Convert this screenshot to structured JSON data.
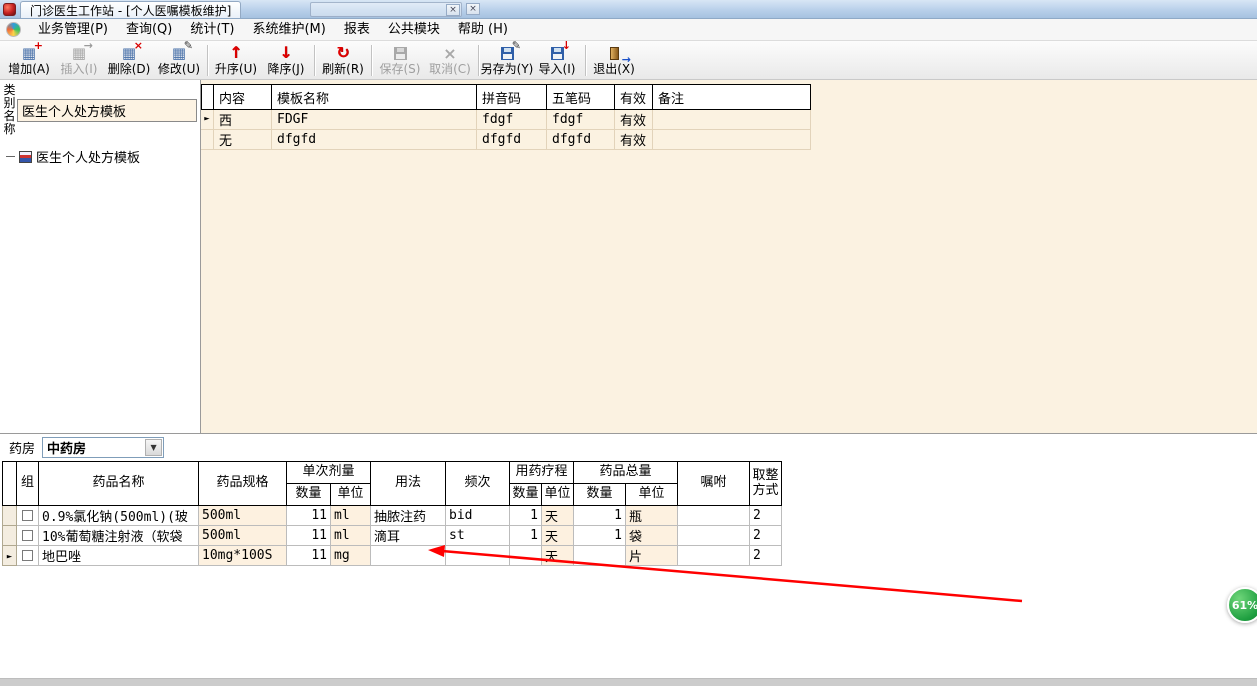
{
  "window": {
    "title": "门诊医生工作站 - [个人医嘱模板维护]"
  },
  "menu_bar": {
    "items": [
      "业务管理(P)",
      "查询(Q)",
      "统计(T)",
      "系统维护(M)",
      "报表",
      "公共模块",
      "帮助 (H)"
    ]
  },
  "toolbar": {
    "buttons": [
      {
        "label": "增加(A)",
        "enabled": true,
        "glyph": "▦",
        "overlay": "+"
      },
      {
        "label": "插入(I)",
        "enabled": false,
        "glyph": "▦",
        "overlay": "→"
      },
      {
        "label": "删除(D)",
        "enabled": true,
        "glyph": "▦",
        "overlay": "×"
      },
      {
        "label": "修改(U)",
        "enabled": true,
        "glyph": "▦",
        "overlay": "✎"
      },
      {
        "label": "升序(U)",
        "enabled": true,
        "glyph": "↑"
      },
      {
        "label": "降序(J)",
        "enabled": true,
        "glyph": "↓"
      },
      {
        "label": "刷新(R)",
        "enabled": true,
        "glyph": "↻"
      },
      {
        "label": "保存(S)",
        "enabled": false
      },
      {
        "label": "取消(C)",
        "enabled": false,
        "glyph": "×"
      },
      {
        "label": "另存为(Y)",
        "enabled": true,
        "overlay": "✎"
      },
      {
        "label": "导入(I)",
        "enabled": true,
        "overlay": "↓"
      },
      {
        "label": "退出(X)",
        "enabled": true,
        "overlay": "→"
      }
    ]
  },
  "icons": {
    "close": "×",
    "chevron_down": "▼",
    "row_marker": "►"
  },
  "left_panel": {
    "category_label_line1": "类别",
    "category_label_line2": "名称",
    "category_value": "医生个人处方模板",
    "tree_item": "医生个人处方模板"
  },
  "template_grid": {
    "headers": [
      "内容",
      "模板名称",
      "拼音码",
      "五笔码",
      "有效",
      "备注"
    ],
    "rows": [
      {
        "content": "西",
        "name": "FDGF",
        "pinyin": "fdgf",
        "wubi": "fdgf",
        "valid": "有效",
        "remark": ""
      },
      {
        "content": "无",
        "name": "dfgfd",
        "pinyin": "dfgfd",
        "wubi": "dfgfd",
        "valid": "有效",
        "remark": ""
      }
    ]
  },
  "pharmacy": {
    "label": "药房",
    "selected": "中药房"
  },
  "drug_grid": {
    "headers": {
      "group": "组",
      "drug_name": "药品名称",
      "spec": "药品规格",
      "single_dose": "单次剂量",
      "qty": "数量",
      "unit": "单位",
      "usage": "用法",
      "frequency": "频次",
      "course": "用药疗程",
      "total": "药品总量",
      "advice": "嘱咐",
      "rounding": "取整方式"
    },
    "rows": [
      {
        "name": "0.9%氯化钠(500ml)(玻",
        "spec": "500ml",
        "dose_qty": "11",
        "dose_unit": "ml",
        "usage": "抽脓注药",
        "freq": "bid",
        "course_qty": "1",
        "course_unit": "天",
        "total_qty": "1",
        "total_unit": "瓶",
        "advice": "",
        "rounding": "2"
      },
      {
        "name": "10%葡萄糖注射液（软袋",
        "spec": "500ml",
        "dose_qty": "11",
        "dose_unit": "ml",
        "usage": "滴耳",
        "freq": "st",
        "course_qty": "1",
        "course_unit": "天",
        "total_qty": "1",
        "total_unit": "袋",
        "advice": "",
        "rounding": "2"
      },
      {
        "name": "地巴唑",
        "spec": "10mg*100S",
        "dose_qty": "11",
        "dose_unit": "mg",
        "usage": "",
        "freq": "",
        "course_qty": "",
        "course_unit": "天",
        "total_qty": "",
        "total_unit": "片",
        "advice": "",
        "rounding": "2"
      }
    ]
  },
  "overlay": {
    "percent_badge": "61%"
  }
}
